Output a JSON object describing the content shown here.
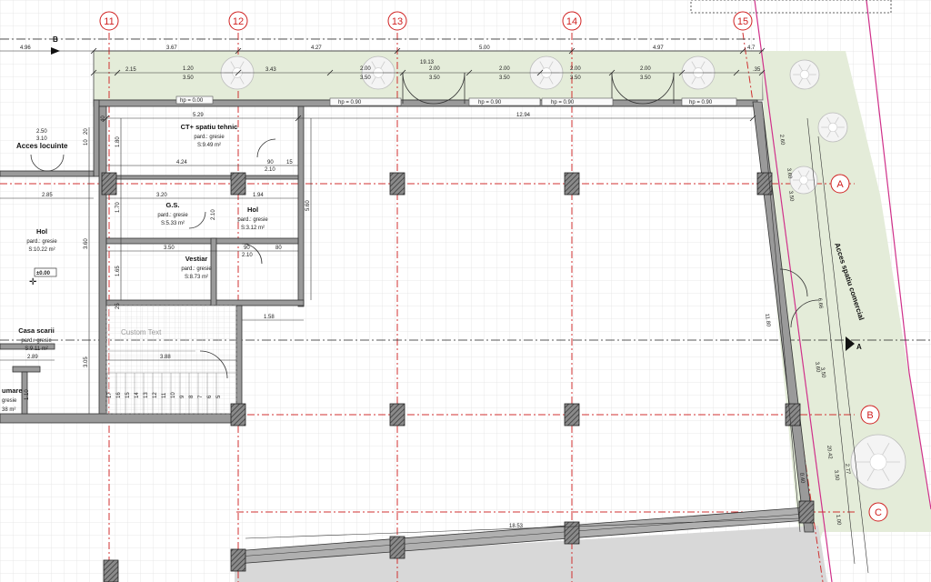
{
  "colors": {
    "grid": "#e2e2e2",
    "axis": "#d03030",
    "wall": "#7a7a7a",
    "green": "#e4ecd9",
    "magenta": "#d0308a",
    "column": "#5a5a5a"
  },
  "axes_vertical": [
    "11",
    "12",
    "13",
    "14",
    "15"
  ],
  "axes_horizontal": [
    "A",
    "B",
    "C"
  ],
  "section_markers": [
    "B",
    "A"
  ],
  "labels": {
    "acces_locuinte": "Acces locuinte",
    "acces_spatiu_comercial": "Acces spatiu comercial",
    "custom_text": "Custom Text",
    "level_mark": "±0.00"
  },
  "rooms": [
    {
      "name": "CT+ spatiu tehnic",
      "finish": "pard.: gresie",
      "area": "S:9.49 m²"
    },
    {
      "name": "G.S.",
      "finish": "pard.: gresie",
      "area": "S:5.33 m²"
    },
    {
      "name": "Hol",
      "finish": "pard.: gresie",
      "area": "S:3.12 m²"
    },
    {
      "name": "Vestiar",
      "finish": "pard.: gresie",
      "area": "S:8.73 m²"
    },
    {
      "name": "Hol",
      "finish": "pard.: gresie",
      "area": "S:10.22 m²"
    },
    {
      "name": "Casa scarii",
      "finish": "pard.: gresie",
      "area": "S:9.11 m²"
    },
    {
      "name": "umare",
      "finish": "gresie",
      "area": "38 m²"
    }
  ],
  "top_dims": [
    "4.96",
    "3.67",
    "4.27",
    "5.00",
    "4.97",
    "4.7"
  ],
  "top_dims_2": [
    "2.15",
    "1.20",
    "3.43",
    "19.13",
    "2.00",
    "2.00",
    "2.00",
    "2.00",
    "2.00",
    ".35"
  ],
  "window_heights": [
    "3.50",
    "3.50",
    "3.50",
    "3.50",
    "3.50",
    "3.50"
  ],
  "hp_labels": [
    "hp = 0.00",
    "hp = 0.90",
    "hp = 0.90",
    "hp = 0.90",
    "hp = 0.90"
  ],
  "interior_dims": {
    "d_5_29": "5.29",
    "d_12_94": "12.94",
    "d_4_24": "4.24",
    "d_90a": "90",
    "d_2_10a": "2.10",
    "d_15": "15",
    "d_3_20": "3.20",
    "d_1_94": "1.94",
    "d_3_50": "3.50",
    "d_90b": "90",
    "d_2_10b": "2.10",
    "d_80": "80",
    "d_1_58": "1.58",
    "d_3_88": "3.88",
    "d_2_89": "2.89",
    "d_2_85": "2.85",
    "d_2_50": "2.50",
    "d_3_10": "3.10",
    "d_18_53": "18.53",
    "d_11_80": "11.80",
    "v_1_80": "1.80",
    "v_1_70": "1.70",
    "v_1_65": "1.65",
    "v_5_60": "5.60",
    "v_3_60": "3.60",
    "v_3_05": "3.05",
    "v_2_10": "2.10",
    "v_40": "40",
    "v_20": "20",
    "v_10": "10",
    "v_25": "25",
    "v_1_10": "1.10"
  },
  "right_dims": [
    "2.60",
    "3.60",
    "3.50",
    "6.66",
    "20.42",
    "3.60",
    "3.50",
    "2.77",
    "3.50",
    "1.00",
    "0.40"
  ],
  "stair_steps": [
    "17",
    "16",
    "15",
    "14",
    "13",
    "12",
    "11",
    "10",
    "9",
    "8",
    "7",
    "6",
    "5"
  ]
}
